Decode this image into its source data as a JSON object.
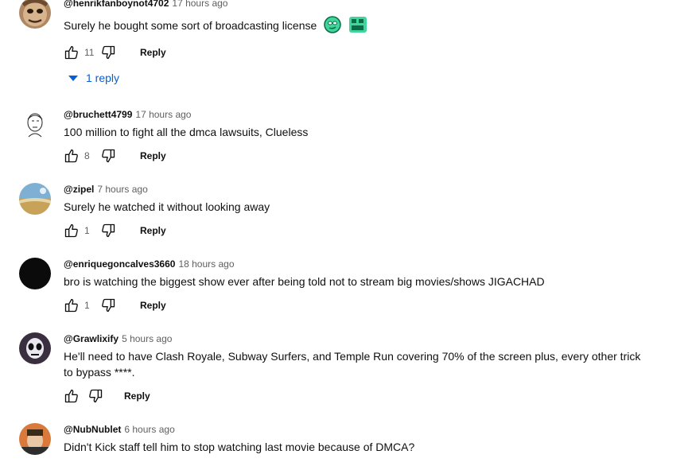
{
  "comments": [
    {
      "author": "@henrikfanboynot4702",
      "time": "17 hours ago",
      "text": "Surely he bought some sort of broadcasting license",
      "emotes": [
        "clueless-emote",
        "bigbrain-emote"
      ],
      "likes": "11",
      "reply_label": "Reply",
      "replies_label": "1 reply",
      "avatar_color": "#8a6b4a"
    },
    {
      "author": "@bruchett4799",
      "time": "17 hours ago",
      "text": "100 million to fight all the dmca lawsuits, Clueless",
      "likes": "8",
      "reply_label": "Reply",
      "avatar_color": "#ffffff"
    },
    {
      "author": "@zipel",
      "time": "7 hours ago",
      "text": "Surely he watched it without looking away",
      "likes": "1",
      "reply_label": "Reply",
      "avatar_color": "#5f8fb5"
    },
    {
      "author": "@enriquegoncalves3660",
      "time": "18 hours ago",
      "text": "bro is watching the biggest show ever after being told not to stream big movies/shows JIGACHAD",
      "likes": "1",
      "reply_label": "Reply",
      "avatar_color": "#0b0b0b"
    },
    {
      "author": "@Grawlixify",
      "time": "5 hours ago",
      "text": "He'll need to have Clash Royale, Subway Surfers, and Temple Run covering 70% of the screen plus, every other trick to bypass ****.",
      "likes": "",
      "reply_label": "Reply",
      "avatar_color": "#3a2f3f"
    },
    {
      "author": "@NubNublet",
      "time": "6 hours ago",
      "text": "Didn't Kick staff tell him to stop watching last movie because of DMCA?",
      "reply_label": "Reply",
      "avatar_color": "#d97a3a"
    }
  ],
  "colors": {
    "link_blue": "#065fd4",
    "secondary_text": "#606060",
    "emote_green": "#3fd59b"
  },
  "icons": [
    "like-icon",
    "dislike-icon",
    "chevron-down-icon"
  ]
}
